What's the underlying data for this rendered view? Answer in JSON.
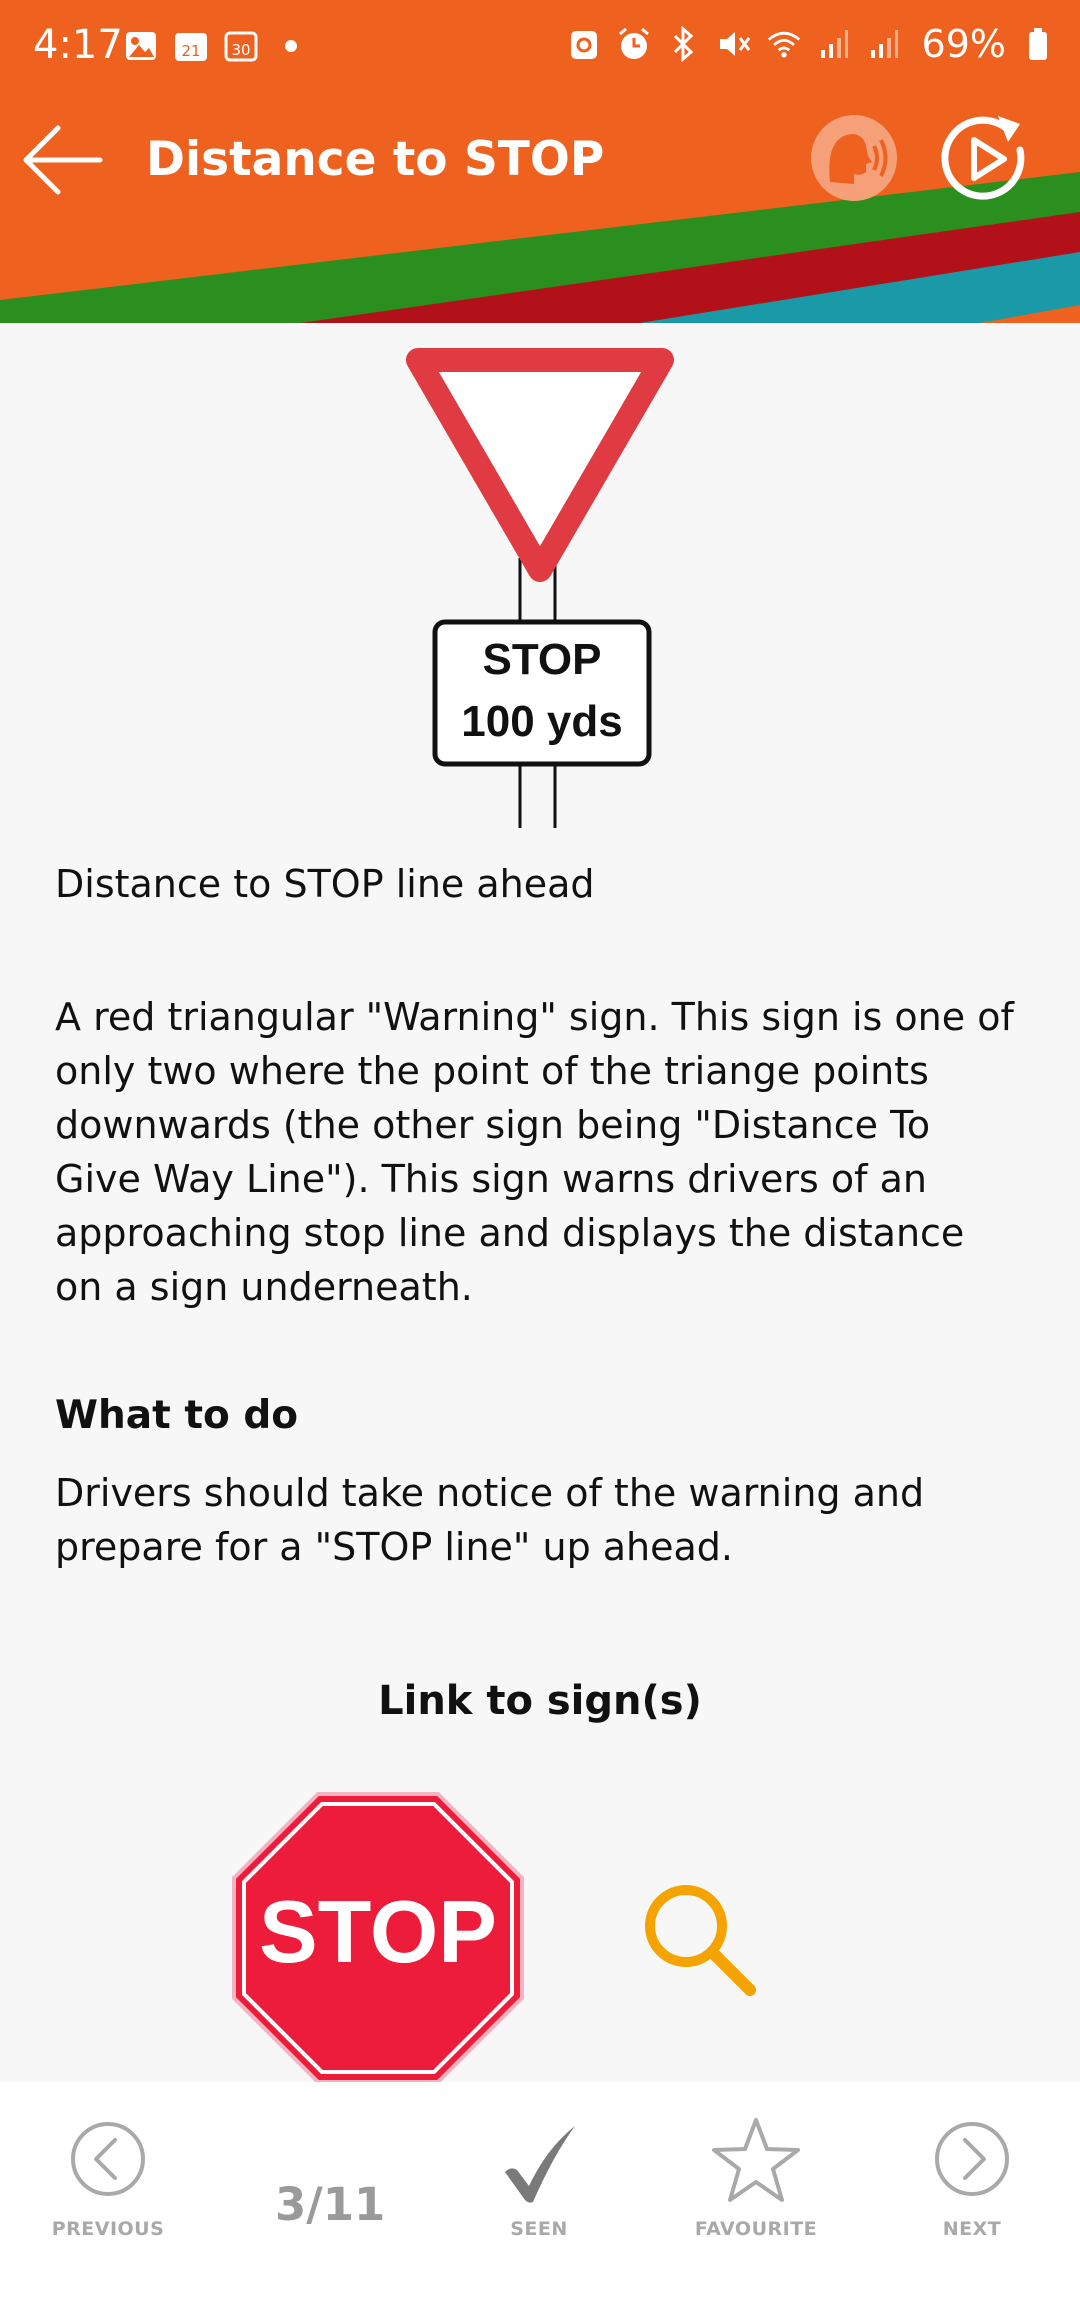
{
  "status_bar": {
    "time": "4:17",
    "calendar_day_1": "21",
    "calendar_day_2": "30",
    "battery": "69%"
  },
  "header": {
    "title": "Distance to STOP",
    "brand_colors": [
      "#ee611e",
      "#2a8f1f",
      "#b3111a",
      "#1a9aa6"
    ]
  },
  "main_sign": {
    "plate_line_1": "STOP",
    "plate_line_2": "100 yds"
  },
  "content": {
    "caption": "Distance to STOP line ahead",
    "description": "A red triangular \"Warning\" sign. This sign is one of only two where the point of the triange points downwards (the other sign being \"Distance To Give Way Line\"). This sign warns drivers of an approaching stop line and displays the distance on a sign underneath.",
    "what_heading": "What to do",
    "what_text": "Drivers should take notice of the warning and prepare for a \"STOP line\" up ahead.",
    "link_heading": "Link to sign(s)",
    "linked_sign_text": "STOP"
  },
  "bottom_nav": {
    "previous": "PREVIOUS",
    "page": "3/11",
    "seen": "SEEN",
    "favourite": "FAVOURITE",
    "next": "NEXT"
  }
}
